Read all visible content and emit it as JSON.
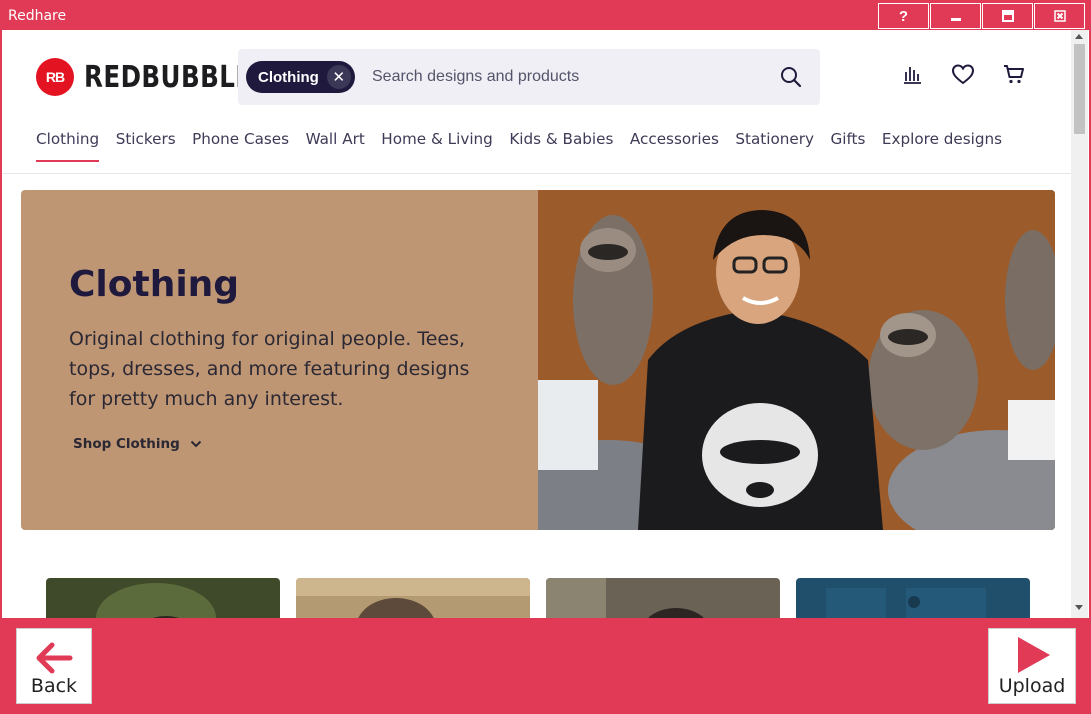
{
  "window": {
    "title": "Redhare",
    "buttons": {
      "help": "?",
      "minimize": "‒",
      "maximize": "▭",
      "close": "✕"
    }
  },
  "header": {
    "logo_mark": "RB",
    "logo_text": "REDBUBBLE",
    "search": {
      "chip_label": "Clothing",
      "placeholder": "Search designs and products"
    }
  },
  "nav": {
    "items": [
      "Clothing",
      "Stickers",
      "Phone Cases",
      "Wall Art",
      "Home & Living",
      "Kids & Babies",
      "Accessories",
      "Stationery",
      "Gifts",
      "Explore designs"
    ],
    "active": "Clothing"
  },
  "hero": {
    "title": "Clothing",
    "description": "Original clothing for original people. Tees, tops, dresses, and more featuring designs for pretty much any interest.",
    "link": "Shop Clothing"
  },
  "bottom": {
    "back_label": "Back",
    "upload_label": "Upload"
  },
  "colors": {
    "accent": "#e03a56",
    "hero_bg": "#be9674",
    "brand_red": "#e41321",
    "dark": "#1f1a3d"
  }
}
